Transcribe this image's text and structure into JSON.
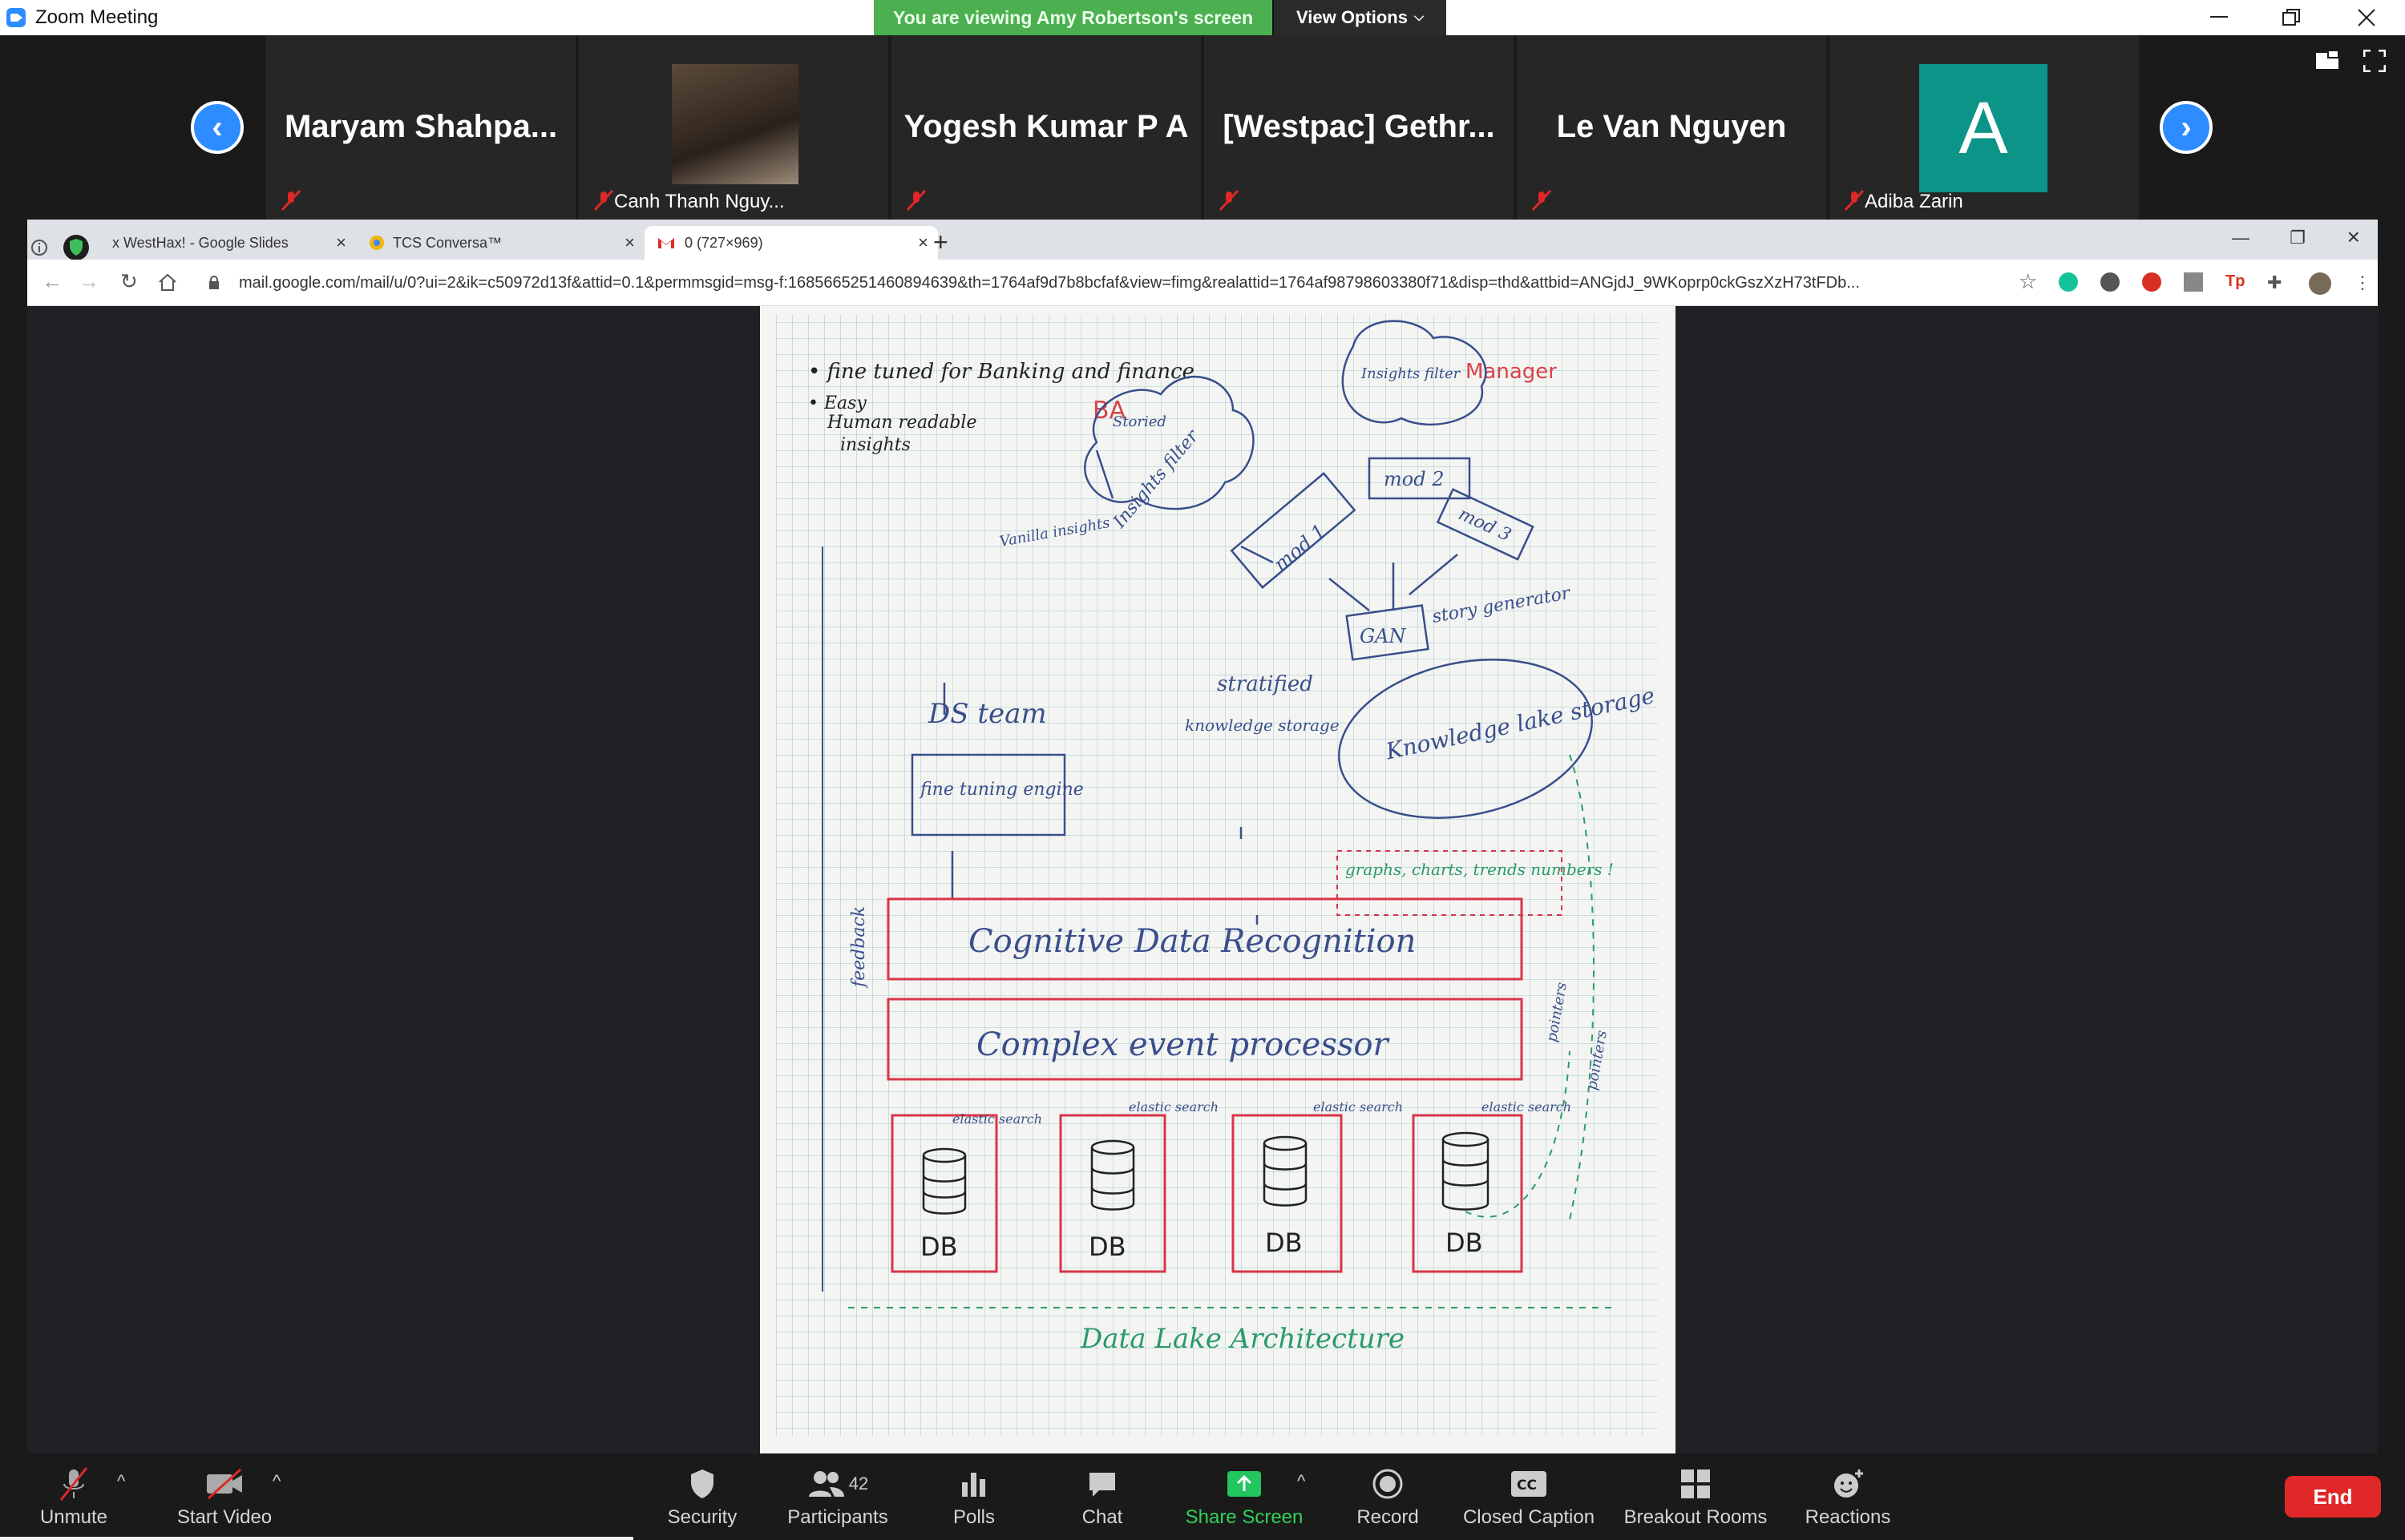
{
  "titlebar": {
    "title": "Zoom Meeting",
    "banner": "You are viewing Amy Robertson's screen",
    "view_options": "View Options"
  },
  "gallery": {
    "tiles": [
      {
        "name": "Maryam  Shahpa...",
        "label": ""
      },
      {
        "name": "",
        "label": "Canh Thanh Nguy..."
      },
      {
        "name": "Yogesh Kumar P A",
        "label": ""
      },
      {
        "name": "[Westpac]  Gethr...",
        "label": ""
      },
      {
        "name": "Le Van Nguyen",
        "label": ""
      },
      {
        "name": "",
        "label": "Adiba Zarin"
      }
    ],
    "avatar_letter": "A"
  },
  "browser": {
    "tabs": [
      {
        "label": "x WestHax! - Google Slides"
      },
      {
        "label": "TCS Conversa™"
      },
      {
        "label": "0 (727×969)"
      }
    ],
    "url": "mail.google.com/mail/u/0?ui=2&ik=c50972d13f&attid=0.1&permmsgid=msg-f:1685665251460894639&th=1764af9d7b8bcfaf&view=fimg&realattid=1764af98798603380f71&disp=thd&attbid=ANGjdJ_9WKoprp0ckGszXzH73tFDb..."
  },
  "sketch": {
    "notes": [
      "• fine tuned for Banking and finance",
      "• Easy",
      "Human readable",
      "insights"
    ],
    "ba": "BA",
    "manager": "Manager",
    "insights_filter": "Insights filter",
    "insights_filter2": "Insights filter",
    "vanilla": "Vanilla insights",
    "storied": "Storied",
    "mod1": "mod 1",
    "mod2": "mod 2",
    "mod3": "mod 3",
    "gan": "GAN",
    "story_gen": "story generator",
    "ds_team": "DS team",
    "fine_tuning": "fine tuning engine",
    "stratified": "stratified",
    "knowledge_storage": "knowledge storage",
    "knowledge_lake": "Knowledge lake storage",
    "graphs": "graphs, charts, trends numbers !",
    "cdr": "Cognitive Data Recognition",
    "cep": "Complex event processor",
    "feedback": "feedback",
    "pointers": "pointers",
    "pointers2": "pointers",
    "elastic": [
      "elastic search",
      "elastic search",
      "elastic search",
      "elastic search"
    ],
    "db": [
      "DB",
      "DB",
      "DB",
      "DB"
    ],
    "footer": "Data Lake Architecture"
  },
  "toolbar": {
    "unmute": "Unmute",
    "start_video": "Start Video",
    "security": "Security",
    "participants": "Participants",
    "participants_count": "42",
    "polls": "Polls",
    "chat": "Chat",
    "share_screen": "Share Screen",
    "record": "Record",
    "closed_caption": "Closed Caption",
    "breakout": "Breakout Rooms",
    "reactions": "Reactions",
    "end": "End"
  }
}
